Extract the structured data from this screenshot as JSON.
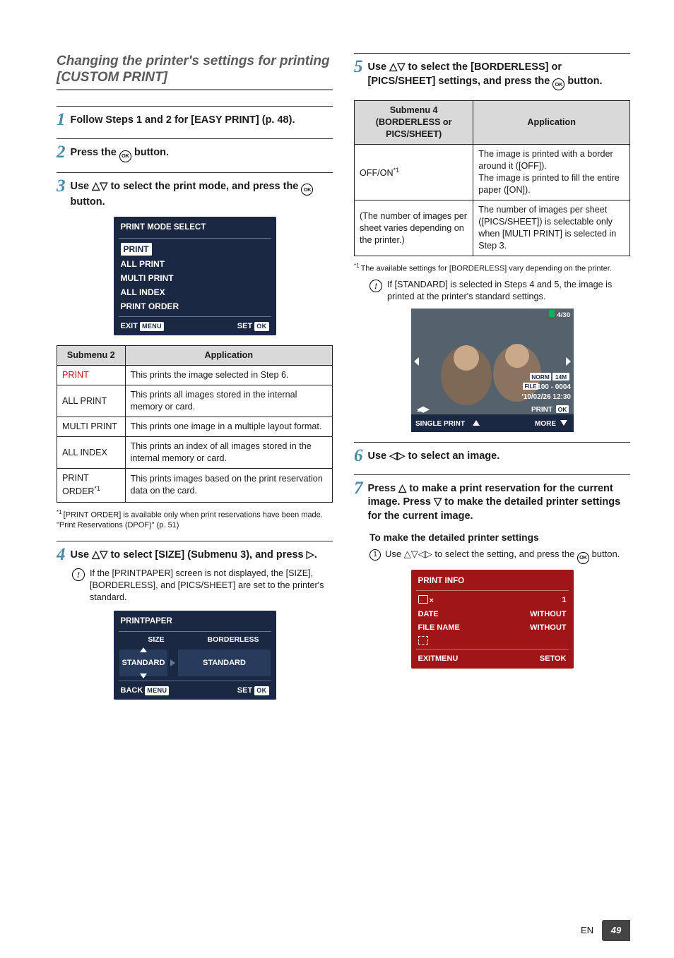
{
  "section_title": "Changing the printer's settings for printing [CUSTOM PRINT]",
  "steps": {
    "s1": {
      "text": "Follow Steps 1 and 2 for [EASY PRINT] (p. 48)."
    },
    "s2": {
      "text_a": "Press the ",
      "text_b": " button."
    },
    "s3": {
      "text_a": "Use ",
      "text_b": " to select the print mode, and press the ",
      "text_c": " button."
    },
    "s4": {
      "text_a": "Use ",
      "text_b": " to select [SIZE] (Submenu 3), and press ",
      "text_c": "."
    },
    "s5": {
      "text_a": "Use ",
      "text_b": " to select the [BORDERLESS] or [PICS/SHEET] settings, and press the ",
      "text_c": " button."
    },
    "s6": {
      "text_a": "Use ",
      "text_b": " to select an image."
    },
    "s7": {
      "text_a": "Press ",
      "text_b": " to make a print reservation for the current image. Press ",
      "text_c": " to make the detailed printer settings for the current image."
    }
  },
  "note4": "If the [PRINTPAPER] screen is not displayed, the [SIZE], [BORDERLESS], and [PICS/SHEET] are set to the printer's standard.",
  "note5": "If [STANDARD] is selected in Steps 4 and 5, the image is printed at the printer's standard settings.",
  "subsub_title": "To make the detailed printer settings",
  "substep1_a": "Use ",
  "substep1_b": " to select the setting, and press the ",
  "substep1_c": " button.",
  "screen_mode": {
    "title": "PRINT MODE SELECT",
    "items": [
      "PRINT",
      "ALL PRINT",
      "MULTI PRINT",
      "ALL INDEX",
      "PRINT ORDER"
    ],
    "footer_l": "EXIT",
    "footer_r": "SET",
    "badge_l": "MENU",
    "badge_r": "OK"
  },
  "screen_paper": {
    "title": "PRINTPAPER",
    "h1": "SIZE",
    "h2": "BORDERLESS",
    "c1": "STANDARD",
    "c2": "STANDARD",
    "footer_l": "BACK",
    "footer_r": "SET",
    "badge_l": "MENU",
    "badge_r": "OK"
  },
  "screen_info": {
    "title": "PRINT INFO",
    "rows": [
      {
        "k": "×",
        "v": "1",
        "icon": "printer"
      },
      {
        "k": "DATE",
        "v": "WITHOUT"
      },
      {
        "k": "FILE NAME",
        "v": "WITHOUT"
      },
      {
        "k": "",
        "v": "",
        "icon": "trim"
      }
    ],
    "footer_l": "EXIT",
    "footer_r": "SET",
    "badge_l": "MENU",
    "badge_r": "OK"
  },
  "preview": {
    "counter": "4/30",
    "norm": "NORM",
    "res": "14M",
    "file": "100-0004",
    "file_prefix": "FILE",
    "date": "'10/02/26 12:30",
    "single": "SINGLE PRINT",
    "print": "PRINT",
    "more": "MORE",
    "ok": "OK"
  },
  "table_sub2": {
    "h1": "Submenu 2",
    "h2": "Application",
    "rows": [
      {
        "a": "PRINT",
        "b": "This prints the image selected in Step 6.",
        "red": true
      },
      {
        "a": "ALL PRINT",
        "b": "This prints all images stored in the internal memory or card."
      },
      {
        "a": "MULTI PRINT",
        "b": "This prints one image in a multiple layout format."
      },
      {
        "a": "ALL INDEX",
        "b": "This prints an index of all images stored in the internal memory or card."
      },
      {
        "a": "PRINT ORDER*1",
        "b": "This prints images based on the print reservation data on the card.",
        "sup": true
      }
    ]
  },
  "footnote_sub2": "[PRINT ORDER] is available only when print reservations have been made. \"Print Reservations (DPOF)\" (p. 51)",
  "table_sub4": {
    "h1_a": "Submenu 4",
    "h1_b": "(BORDERLESS or PICS/SHEET)",
    "h2": "Application",
    "rows": [
      {
        "a": "OFF/ON*1",
        "b": "The image is printed with a border around it ([OFF]).\nThe image is printed to fill the entire paper ([ON]).",
        "sup": true
      },
      {
        "a": "(The number of images per sheet varies depending on the printer.)",
        "b": "The number of images per sheet ([PICS/SHEET]) is selectable only when [MULTI PRINT] is selected in Step 3."
      }
    ]
  },
  "footnote_sub4": "The available settings for [BORDERLESS] vary depending on the printer.",
  "footer": {
    "lang": "EN",
    "page": "49"
  }
}
